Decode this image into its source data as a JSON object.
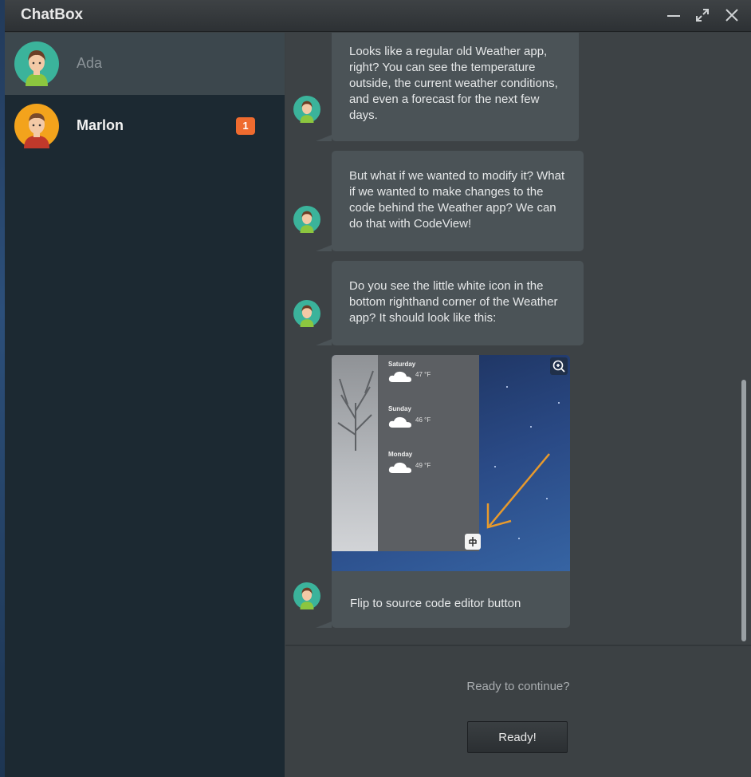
{
  "window": {
    "title": "ChatBox"
  },
  "contacts": [
    {
      "name": "Ada",
      "active": true
    },
    {
      "name": "Marlon",
      "unread": "1"
    }
  ],
  "messages": [
    {
      "text": "Looks like a regular old Weather app, right? You can see the temperature outside, the current weather conditions, and even a forecast for the next few days."
    },
    {
      "text": "But what if we wanted to modify it? What if we wanted to make changes to the code behind the Weather app? We can do that with CodeView!"
    },
    {
      "text": "Do you see the little white icon in the bottom righthand corner of the Weather app? It should look like this:"
    },
    {
      "caption": "Flip to source code editor button",
      "image": {
        "forecast": [
          {
            "day": "Saturday",
            "temp": "47 °F"
          },
          {
            "day": "Sunday",
            "temp": "46 °F"
          },
          {
            "day": "Monday",
            "temp": "49 °F"
          }
        ]
      }
    }
  ],
  "footer": {
    "prompt": "Ready to continue?",
    "button_label": "Ready!"
  },
  "colors": {
    "badge": "#ef6b2f",
    "arrow": "#e89a2c",
    "sidebar": "#1c2932",
    "chat_bg": "#3d4245"
  }
}
